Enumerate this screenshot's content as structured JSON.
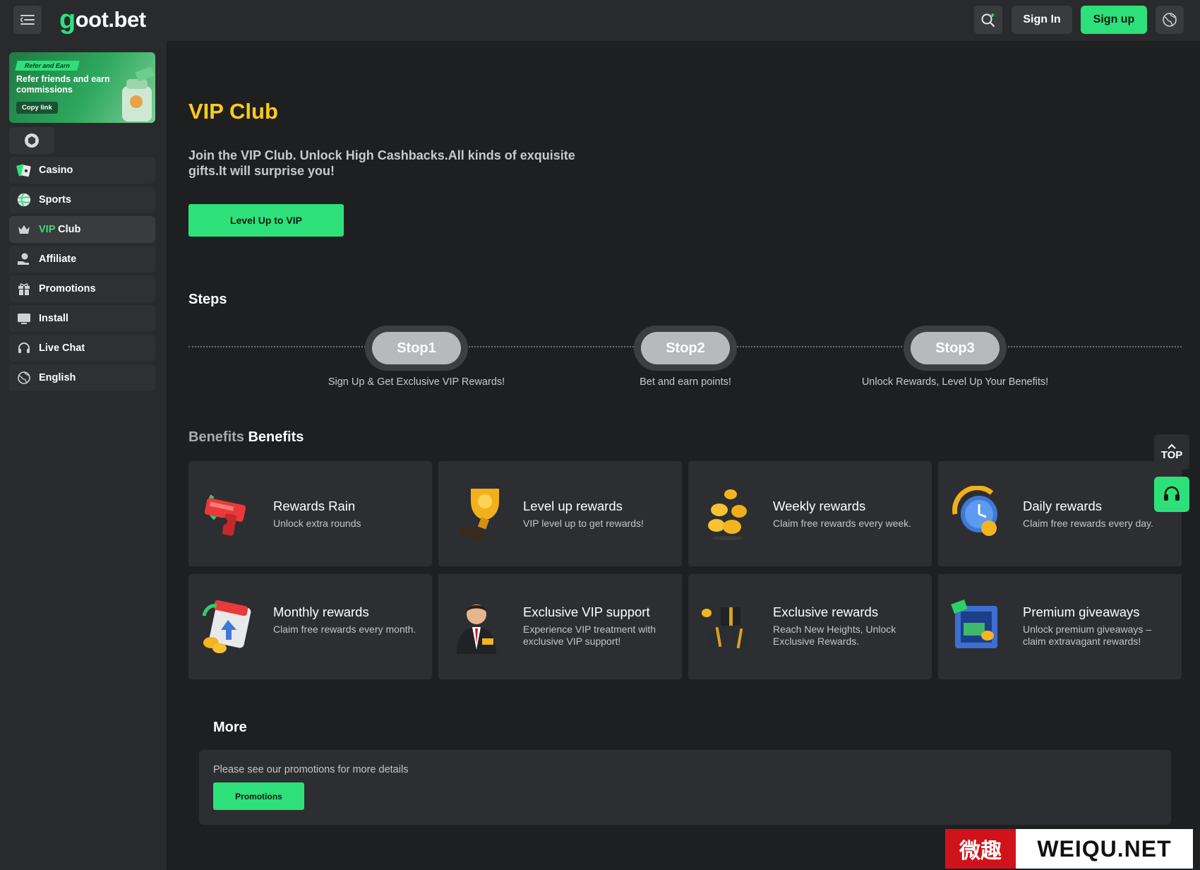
{
  "header": {
    "logo_mark": "g",
    "logo_text": "oot.bet",
    "signin_label": "Sign In",
    "signup_label": "Sign up"
  },
  "sidebar": {
    "promo": {
      "tag": "Refer and Earn",
      "title": "Refer friends and earn commissions",
      "copy_label": "Copy link"
    },
    "items": [
      {
        "label": "Casino",
        "icon": "casino-icon"
      },
      {
        "label": "Sports",
        "icon": "sports-icon"
      },
      {
        "label_prefix": "VIP",
        "label": " Club",
        "icon": "crown-icon"
      },
      {
        "label": "Affiliate",
        "icon": "affiliate-icon"
      },
      {
        "label": "Promotions",
        "icon": "gift-icon"
      },
      {
        "label": "Install",
        "icon": "monitor-icon"
      },
      {
        "label": "Live Chat",
        "icon": "headset-icon"
      },
      {
        "label": "English",
        "icon": "globe-icon"
      }
    ]
  },
  "main": {
    "title": "VIP Club",
    "intro": "Join the VIP Club. Unlock High Cashbacks.All kinds of exquisite gifts.It will surprise you!",
    "level_button": "Level Up to VIP",
    "steps_title": "Steps",
    "steps": [
      {
        "label": "Stop1",
        "desc": "Sign Up & Get Exclusive VIP Rewards!"
      },
      {
        "label": "Stop2",
        "desc": "Bet and earn points!"
      },
      {
        "label": "Stop3",
        "desc": "Unlock Rewards, Level Up Your Benefits!"
      }
    ],
    "benefits_title_a": "Benefits",
    "benefits_title_b": " Benefits",
    "benefits": [
      {
        "title": "Rewards Rain",
        "desc": "Unlock extra rounds",
        "icon": "money-gun-icon"
      },
      {
        "title": "Level up rewards",
        "desc": "VIP level up to get rewards!",
        "icon": "trophy-icon"
      },
      {
        "title": "Weekly rewards",
        "desc": "Claim free rewards every week.",
        "icon": "coins-icon"
      },
      {
        "title": "Daily rewards",
        "desc": "Claim free rewards every day.",
        "icon": "clock-icon"
      },
      {
        "title": "Monthly rewards",
        "desc": "Claim free rewards every month.",
        "icon": "calendar-icon"
      },
      {
        "title": "Exclusive VIP support",
        "desc": "Experience VIP treatment with exclusive VIP support!",
        "icon": "vip-agent-icon"
      },
      {
        "title": "Exclusive rewards",
        "desc": "Reach New Heights, Unlock Exclusive Rewards.",
        "icon": "gift-boxes-icon"
      },
      {
        "title": "Premium giveaways",
        "desc": "Unlock premium giveaways – claim extravagant rewards!",
        "icon": "cash-safe-icon"
      }
    ],
    "top_label": "TOP",
    "more_title": "More",
    "more_text": "Please see our promotions for more details",
    "more_button": "Promotions"
  },
  "watermark": {
    "cn": "微趣",
    "en": "WEIQU.NET"
  },
  "colors": {
    "accent": "#2ee07a",
    "title_gold": "#ffcc18",
    "bg": "#1e1f20",
    "panel": "#292a2c",
    "card": "#2d2e31"
  }
}
